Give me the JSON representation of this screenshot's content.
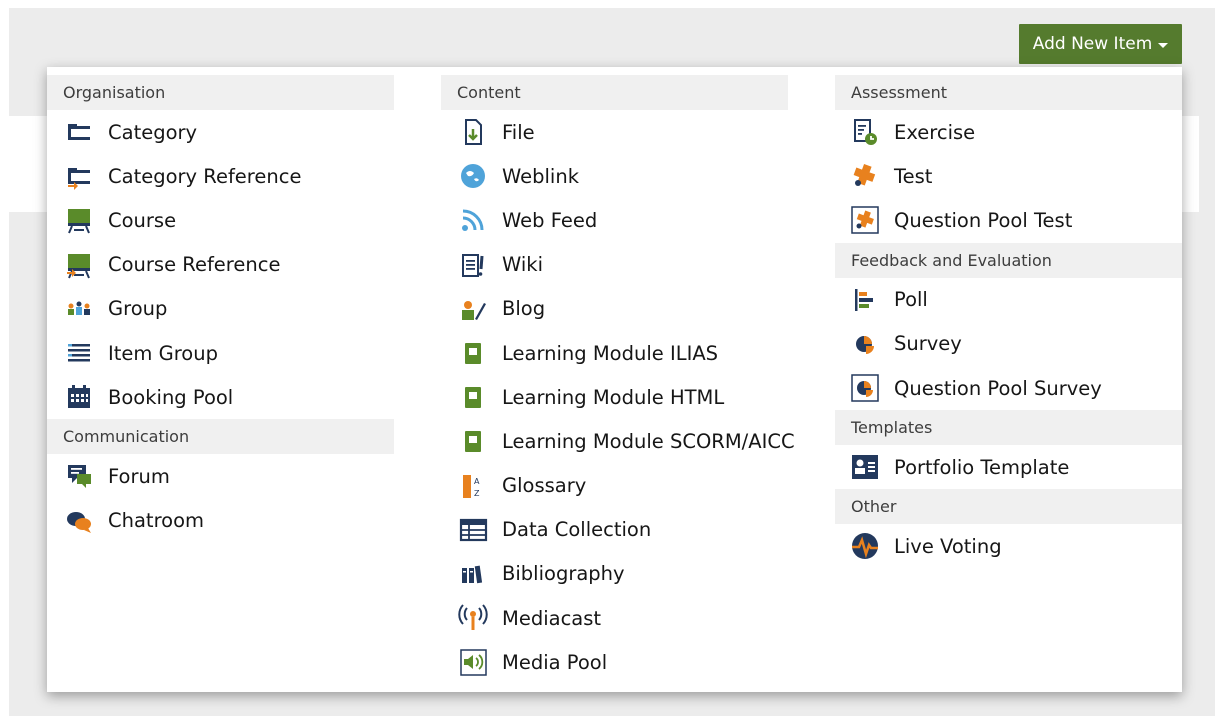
{
  "add_button": {
    "label": "Add New Item"
  },
  "columns": [
    {
      "groups": [
        {
          "header": "Organisation",
          "items": [
            {
              "label": "Category",
              "icon": "category-icon"
            },
            {
              "label": "Category Reference",
              "icon": "category-reference-icon"
            },
            {
              "label": "Course",
              "icon": "course-icon"
            },
            {
              "label": "Course Reference",
              "icon": "course-reference-icon"
            },
            {
              "label": "Group",
              "icon": "group-icon"
            },
            {
              "label": "Item Group",
              "icon": "item-group-icon"
            },
            {
              "label": "Booking Pool",
              "icon": "booking-pool-icon"
            }
          ]
        },
        {
          "header": "Communication",
          "items": [
            {
              "label": "Forum",
              "icon": "forum-icon"
            },
            {
              "label": "Chatroom",
              "icon": "chatroom-icon"
            }
          ]
        }
      ]
    },
    {
      "groups": [
        {
          "header": "Content",
          "items": [
            {
              "label": "File",
              "icon": "file-icon"
            },
            {
              "label": "Weblink",
              "icon": "weblink-icon"
            },
            {
              "label": "Web Feed",
              "icon": "web-feed-icon"
            },
            {
              "label": "Wiki",
              "icon": "wiki-icon"
            },
            {
              "label": "Blog",
              "icon": "blog-icon"
            },
            {
              "label": "Learning Module ILIAS",
              "icon": "learning-module-icon"
            },
            {
              "label": "Learning Module HTML",
              "icon": "learning-module-icon"
            },
            {
              "label": "Learning Module SCORM/AICC",
              "icon": "learning-module-icon"
            },
            {
              "label": "Glossary",
              "icon": "glossary-icon"
            },
            {
              "label": "Data Collection",
              "icon": "data-collection-icon"
            },
            {
              "label": "Bibliography",
              "icon": "bibliography-icon"
            },
            {
              "label": "Mediacast",
              "icon": "mediacast-icon"
            },
            {
              "label": "Media Pool",
              "icon": "media-pool-icon"
            }
          ]
        }
      ]
    },
    {
      "groups": [
        {
          "header": "Assessment",
          "items": [
            {
              "label": "Exercise",
              "icon": "exercise-icon"
            },
            {
              "label": "Test",
              "icon": "test-icon"
            },
            {
              "label": "Question Pool Test",
              "icon": "question-pool-test-icon"
            }
          ]
        },
        {
          "header": "Feedback and Evaluation",
          "items": [
            {
              "label": "Poll",
              "icon": "poll-icon"
            },
            {
              "label": "Survey",
              "icon": "survey-icon"
            },
            {
              "label": "Question Pool Survey",
              "icon": "question-pool-survey-icon"
            }
          ]
        },
        {
          "header": "Templates",
          "items": [
            {
              "label": "Portfolio Template",
              "icon": "portfolio-template-icon"
            }
          ]
        },
        {
          "header": "Other",
          "items": [
            {
              "label": "Live Voting",
              "icon": "live-voting-icon"
            }
          ]
        }
      ]
    }
  ],
  "colors": {
    "button_bg": "#557b2e",
    "header_bg": "#f0f0f0",
    "icon_blue": "#23395d",
    "icon_green": "#5a8b2a",
    "icon_orange": "#e8811e",
    "icon_lightblue": "#4fa3d9"
  }
}
